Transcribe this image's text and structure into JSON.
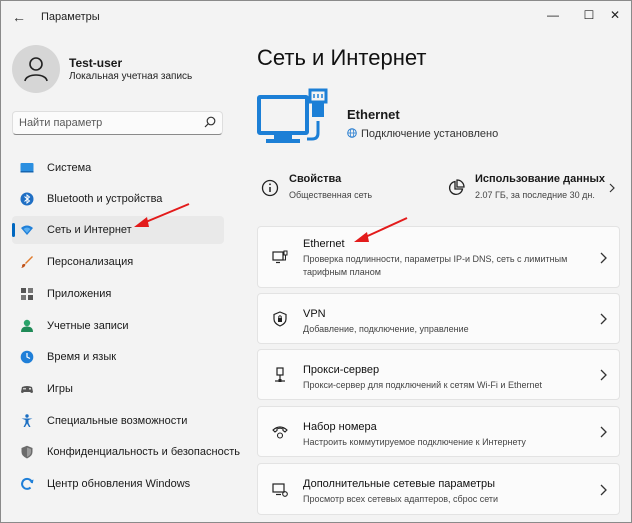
{
  "window": {
    "title": "Параметры"
  },
  "user": {
    "name": "Test-user",
    "account_type": "Локальная учетная запись"
  },
  "search": {
    "placeholder": "Найти параметр"
  },
  "sidebar": {
    "items": [
      {
        "label": "Система",
        "icon": "monitor-icon"
      },
      {
        "label": "Bluetooth и устройства",
        "icon": "bluetooth-icon"
      },
      {
        "label": "Сеть и Интернет",
        "icon": "network-icon",
        "active": true
      },
      {
        "label": "Персонализация",
        "icon": "brush-icon"
      },
      {
        "label": "Приложения",
        "icon": "apps-icon"
      },
      {
        "label": "Учетные записи",
        "icon": "person-icon"
      },
      {
        "label": "Время и язык",
        "icon": "clock-globe-icon"
      },
      {
        "label": "Игры",
        "icon": "gamepad-icon"
      },
      {
        "label": "Специальные возможности",
        "icon": "accessibility-icon"
      },
      {
        "label": "Конфиденциальность и безопасность",
        "icon": "shield-icon"
      },
      {
        "label": "Центр обновления Windows",
        "icon": "update-icon"
      }
    ]
  },
  "main": {
    "title": "Сеть и Интернет",
    "connection": {
      "name": "Ethernet",
      "status": "Подключение установлено"
    },
    "properties": {
      "title": "Свойства",
      "subtitle": "Общественная сеть"
    },
    "data_usage": {
      "title": "Использование данных",
      "subtitle": "2.07 ГБ, за последние 30 дн."
    },
    "cards": [
      {
        "title": "Ethernet",
        "subtitle": "Проверка подлинности, параметры IP-и DNS, сеть с лимитным тарифным планом",
        "icon": "ethernet-icon"
      },
      {
        "title": "VPN",
        "subtitle": "Добавление, подключение, управление",
        "icon": "vpn-shield-icon"
      },
      {
        "title": "Прокси-сервер",
        "subtitle": "Прокси-сервер для подключений к сетям Wi-Fi и Ethernet",
        "icon": "proxy-icon"
      },
      {
        "title": "Набор номера",
        "subtitle": "Настроить коммутируемое подключение к Интернету",
        "icon": "dialup-icon"
      },
      {
        "title": "Дополнительные сетевые параметры",
        "subtitle": "Просмотр всех сетевых адаптеров, сброс сети",
        "icon": "advanced-network-icon"
      }
    ]
  },
  "colors": {
    "accent": "#0067c0",
    "arrow": "#e31b1b",
    "ethernet_graphic": "#1c7fd6"
  }
}
